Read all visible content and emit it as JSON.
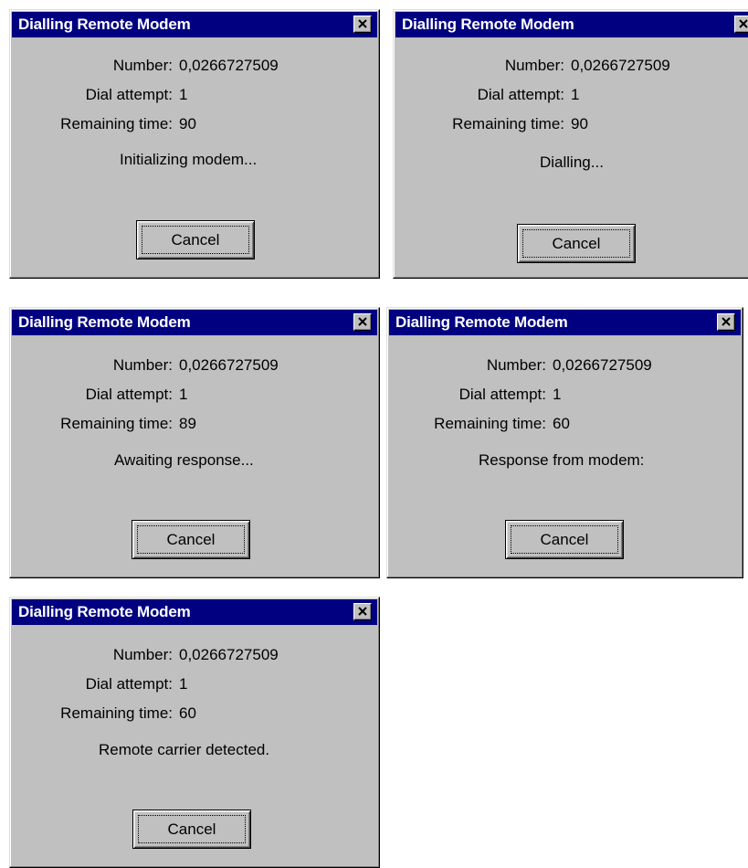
{
  "dialogs": [
    {
      "title": "Dialling Remote Modem",
      "number_label": "Number:",
      "number": "0,0266727509",
      "attempt_label": "Dial attempt:",
      "attempt": "1",
      "time_label": "Remaining time:",
      "time": "90",
      "status": "Initializing modem...",
      "cancel": "Cancel"
    },
    {
      "title": "Dialling Remote Modem",
      "number_label": "Number:",
      "number": "0,0266727509",
      "attempt_label": "Dial attempt:",
      "attempt": "1",
      "time_label": "Remaining time:",
      "time": "90",
      "status": "Dialling...",
      "cancel": "Cancel"
    },
    {
      "title": "Dialling Remote Modem",
      "number_label": "Number:",
      "number": "0,0266727509",
      "attempt_label": "Dial attempt:",
      "attempt": "1",
      "time_label": "Remaining time:",
      "time": "89",
      "status": "Awaiting response...",
      "cancel": "Cancel"
    },
    {
      "title": "Dialling Remote Modem",
      "number_label": "Number:",
      "number": "0,0266727509",
      "attempt_label": "Dial attempt:",
      "attempt": "1",
      "time_label": "Remaining time:",
      "time": "60",
      "status": "Response from modem:",
      "cancel": "Cancel"
    },
    {
      "title": "Dialling Remote Modem",
      "number_label": "Number:",
      "number": "0,0266727509",
      "attempt_label": "Dial attempt:",
      "attempt": "1",
      "time_label": "Remaining time:",
      "time": "60",
      "status": "Remote carrier detected.",
      "cancel": "Cancel"
    }
  ]
}
